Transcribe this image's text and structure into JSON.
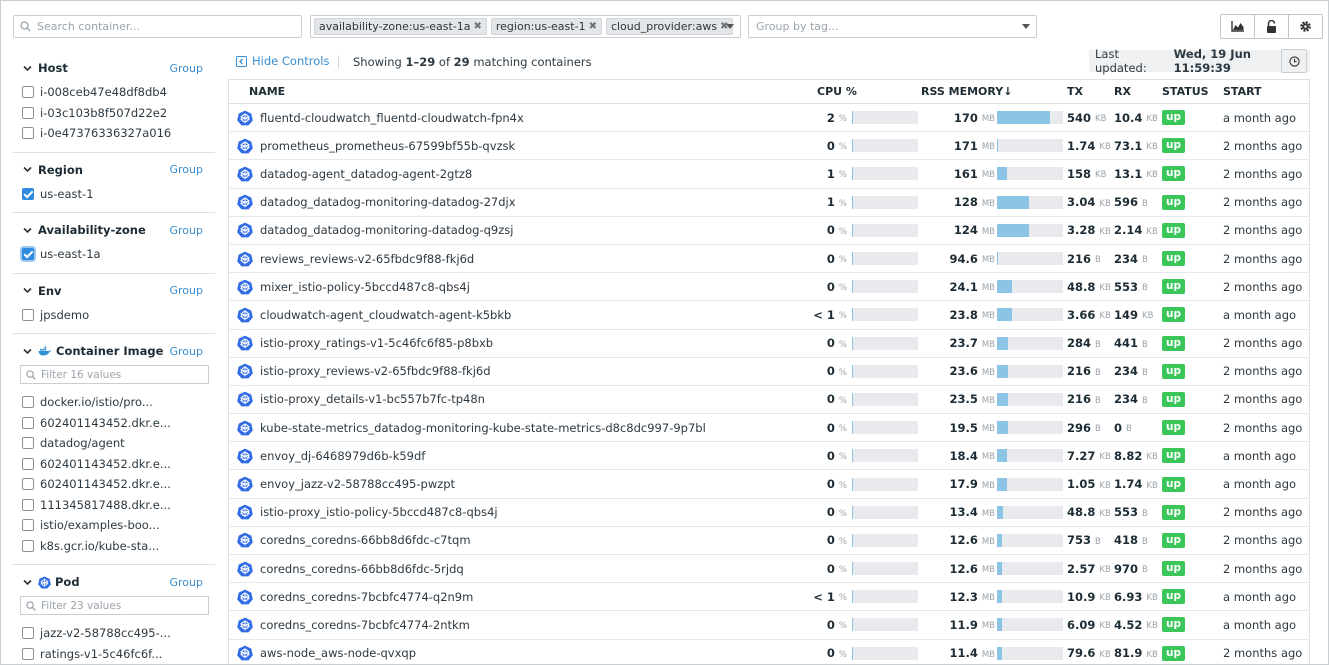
{
  "topbar": {
    "search_placeholder": "Search container...",
    "tags": [
      "availability-zone:us-east-1a",
      "region:us-east-1",
      "cloud_provider:aws"
    ],
    "group_by_placeholder": "Group by tag..."
  },
  "sidebar": {
    "host": {
      "title": "Host",
      "group": "Group",
      "items": [
        "i-008ceb47e48df8db4",
        "i-03c103b8f507d22e2",
        "i-0e47376336327a016"
      ]
    },
    "region": {
      "title": "Region",
      "group": "Group",
      "items": [
        "us-east-1"
      ]
    },
    "az": {
      "title": "Availability-zone",
      "group": "Group",
      "items": [
        "us-east-1a"
      ]
    },
    "env": {
      "title": "Env",
      "group": "Group",
      "items": [
        "jpsdemo"
      ]
    },
    "image": {
      "title": "Container Image",
      "group": "Group",
      "filter_placeholder": "Filter 16 values",
      "items": [
        "docker.io/istio/pro...",
        "602401143452.dkr.e...",
        "datadog/agent",
        "602401143452.dkr.e...",
        "602401143452.dkr.e...",
        "111345817488.dkr.e...",
        "istio/examples-boo...",
        "k8s.gcr.io/kube-sta..."
      ]
    },
    "pod": {
      "title": "Pod",
      "group": "Group",
      "filter_placeholder": "Filter 23 values",
      "items": [
        "jazz-v2-58788cc495-...",
        "ratings-v1-5c46fc6f..."
      ]
    }
  },
  "controls": {
    "hide_label": "Hide Controls",
    "showing_prefix": "Showing",
    "showing_range": "1–29",
    "showing_of": "of",
    "showing_total": "29",
    "showing_suffix": "matching containers",
    "updated_label": "Last updated:",
    "updated_value": "Wed, 19 Jun 11:59:39"
  },
  "table": {
    "headers": {
      "name": "NAME",
      "cpu": "CPU %",
      "mem": "RSS MEMORY↓",
      "tx": "TX",
      "rx": "RX",
      "status": "STATUS",
      "start": "START"
    },
    "rows": [
      {
        "name": "fluentd-cloudwatch_fluentd-cloudwatch-fpn4x",
        "cpu": "2",
        "cpu_unit": "%",
        "cpu_frac": 0.02,
        "mem": "170",
        "mem_unit": "MB",
        "mem_frac": 0.8,
        "tx": "540",
        "tx_unit": "KB",
        "rx": "10.4",
        "rx_unit": "KB",
        "status": "up",
        "start": "a month ago"
      },
      {
        "name": "prometheus_prometheus-67599bf55b-qvzsk",
        "cpu": "0",
        "cpu_unit": "%",
        "cpu_frac": 0,
        "mem": "171",
        "mem_unit": "MB",
        "mem_frac": 0.02,
        "tx": "1.74",
        "tx_unit": "KB",
        "rx": "73.1",
        "rx_unit": "KB",
        "status": "up",
        "start": "2 months ago"
      },
      {
        "name": "datadog-agent_datadog-agent-2gtz8",
        "cpu": "1",
        "cpu_unit": "%",
        "cpu_frac": 0.01,
        "mem": "161",
        "mem_unit": "MB",
        "mem_frac": 0.15,
        "tx": "158",
        "tx_unit": "KB",
        "rx": "13.1",
        "rx_unit": "KB",
        "status": "up",
        "start": "2 months ago"
      },
      {
        "name": "datadog_datadog-monitoring-datadog-27djx",
        "cpu": "1",
        "cpu_unit": "%",
        "cpu_frac": 0.01,
        "mem": "128",
        "mem_unit": "MB",
        "mem_frac": 0.48,
        "tx": "3.04",
        "tx_unit": "KB",
        "rx": "596",
        "rx_unit": "B",
        "status": "up",
        "start": "2 months ago"
      },
      {
        "name": "datadog_datadog-monitoring-datadog-q9zsj",
        "cpu": "0",
        "cpu_unit": "%",
        "cpu_frac": 0,
        "mem": "124",
        "mem_unit": "MB",
        "mem_frac": 0.48,
        "tx": "3.28",
        "tx_unit": "KB",
        "rx": "2.14",
        "rx_unit": "KB",
        "status": "up",
        "start": "2 months ago"
      },
      {
        "name": "reviews_reviews-v2-65fbdc9f88-fkj6d",
        "cpu": "0",
        "cpu_unit": "%",
        "cpu_frac": 0,
        "mem": "94.6",
        "mem_unit": "MB",
        "mem_frac": 0.02,
        "tx": "216",
        "tx_unit": "B",
        "rx": "234",
        "rx_unit": "B",
        "status": "up",
        "start": "2 months ago"
      },
      {
        "name": "mixer_istio-policy-5bccd487c8-qbs4j",
        "cpu": "0",
        "cpu_unit": "%",
        "cpu_frac": 0,
        "mem": "24.1",
        "mem_unit": "MB",
        "mem_frac": 0.22,
        "tx": "48.8",
        "tx_unit": "KB",
        "rx": "553",
        "rx_unit": "B",
        "status": "up",
        "start": "2 months ago"
      },
      {
        "name": "cloudwatch-agent_cloudwatch-agent-k5bkb",
        "cpu": "< 1",
        "cpu_unit": "%",
        "cpu_frac": 0,
        "mem": "23.8",
        "mem_unit": "MB",
        "mem_frac": 0.22,
        "tx": "3.66",
        "tx_unit": "KB",
        "rx": "149",
        "rx_unit": "KB",
        "status": "up",
        "start": "a month ago"
      },
      {
        "name": "istio-proxy_ratings-v1-5c46fc6f85-p8bxb",
        "cpu": "0",
        "cpu_unit": "%",
        "cpu_frac": 0,
        "mem": "23.7",
        "mem_unit": "MB",
        "mem_frac": 0.17,
        "tx": "284",
        "tx_unit": "B",
        "rx": "441",
        "rx_unit": "B",
        "status": "up",
        "start": "2 months ago"
      },
      {
        "name": "istio-proxy_reviews-v2-65fbdc9f88-fkj6d",
        "cpu": "0",
        "cpu_unit": "%",
        "cpu_frac": 0,
        "mem": "23.6",
        "mem_unit": "MB",
        "mem_frac": 0.17,
        "tx": "216",
        "tx_unit": "B",
        "rx": "234",
        "rx_unit": "B",
        "status": "up",
        "start": "2 months ago"
      },
      {
        "name": "istio-proxy_details-v1-bc557b7fc-tp48n",
        "cpu": "0",
        "cpu_unit": "%",
        "cpu_frac": 0,
        "mem": "23.5",
        "mem_unit": "MB",
        "mem_frac": 0.17,
        "tx": "216",
        "tx_unit": "B",
        "rx": "234",
        "rx_unit": "B",
        "status": "up",
        "start": "2 months ago"
      },
      {
        "name": "kube-state-metrics_datadog-monitoring-kube-state-metrics-d8c8dc997-9p7bl",
        "cpu": "0",
        "cpu_unit": "%",
        "cpu_frac": 0,
        "mem": "19.5",
        "mem_unit": "MB",
        "mem_frac": 0.16,
        "tx": "296",
        "tx_unit": "B",
        "rx": "0",
        "rx_unit": "B",
        "status": "up",
        "start": "2 months ago"
      },
      {
        "name": "envoy_dj-6468979d6b-k59df",
        "cpu": "0",
        "cpu_unit": "%",
        "cpu_frac": 0,
        "mem": "18.4",
        "mem_unit": "MB",
        "mem_frac": 0.15,
        "tx": "7.27",
        "tx_unit": "KB",
        "rx": "8.82",
        "rx_unit": "KB",
        "status": "up",
        "start": "a month ago"
      },
      {
        "name": "envoy_jazz-v2-58788cc495-pwzpt",
        "cpu": "0",
        "cpu_unit": "%",
        "cpu_frac": 0,
        "mem": "17.9",
        "mem_unit": "MB",
        "mem_frac": 0.15,
        "tx": "1.05",
        "tx_unit": "KB",
        "rx": "1.74",
        "rx_unit": "KB",
        "status": "up",
        "start": "a month ago"
      },
      {
        "name": "istio-proxy_istio-policy-5bccd487c8-qbs4j",
        "cpu": "0",
        "cpu_unit": "%",
        "cpu_frac": 0,
        "mem": "13.4",
        "mem_unit": "MB",
        "mem_frac": 0.09,
        "tx": "48.8",
        "tx_unit": "KB",
        "rx": "553",
        "rx_unit": "B",
        "status": "up",
        "start": "2 months ago"
      },
      {
        "name": "coredns_coredns-66bb8d6fdc-c7tqm",
        "cpu": "0",
        "cpu_unit": "%",
        "cpu_frac": 0,
        "mem": "12.6",
        "mem_unit": "MB",
        "mem_frac": 0.07,
        "tx": "753",
        "tx_unit": "B",
        "rx": "418",
        "rx_unit": "B",
        "status": "up",
        "start": "2 months ago"
      },
      {
        "name": "coredns_coredns-66bb8d6fdc-5rjdq",
        "cpu": "0",
        "cpu_unit": "%",
        "cpu_frac": 0,
        "mem": "12.6",
        "mem_unit": "MB",
        "mem_frac": 0.07,
        "tx": "2.57",
        "tx_unit": "KB",
        "rx": "970",
        "rx_unit": "B",
        "status": "up",
        "start": "2 months ago"
      },
      {
        "name": "coredns_coredns-7bcbfc4774-q2n9m",
        "cpu": "< 1",
        "cpu_unit": "%",
        "cpu_frac": 0,
        "mem": "12.3",
        "mem_unit": "MB",
        "mem_frac": 0.07,
        "tx": "10.9",
        "tx_unit": "KB",
        "rx": "6.93",
        "rx_unit": "KB",
        "status": "up",
        "start": "a month ago"
      },
      {
        "name": "coredns_coredns-7bcbfc4774-2ntkm",
        "cpu": "0",
        "cpu_unit": "%",
        "cpu_frac": 0,
        "mem": "11.9",
        "mem_unit": "MB",
        "mem_frac": 0.07,
        "tx": "6.09",
        "tx_unit": "KB",
        "rx": "4.52",
        "rx_unit": "KB",
        "status": "up",
        "start": "a month ago"
      },
      {
        "name": "aws-node_aws-node-qvxqp",
        "cpu": "0",
        "cpu_unit": "%",
        "cpu_frac": 0,
        "mem": "11.4",
        "mem_unit": "MB",
        "mem_frac": 0.07,
        "tx": "79.6",
        "tx_unit": "KB",
        "rx": "81.9",
        "rx_unit": "KB",
        "status": "up",
        "start": "2 months ago"
      }
    ]
  },
  "colors": {
    "accent": "#3a8ed0",
    "status_up": "#3bc65a",
    "bar_fill": "#8cc4e6",
    "bar_bg": "#e8eaed"
  },
  "icons": [
    "search-icon",
    "remove-tag-icon",
    "dropdown-caret-icon",
    "chart-icon",
    "lock-icon",
    "gear-icon",
    "collapse-icon",
    "clock-icon",
    "chevron-down-icon",
    "docker-icon",
    "kubernetes-icon"
  ]
}
